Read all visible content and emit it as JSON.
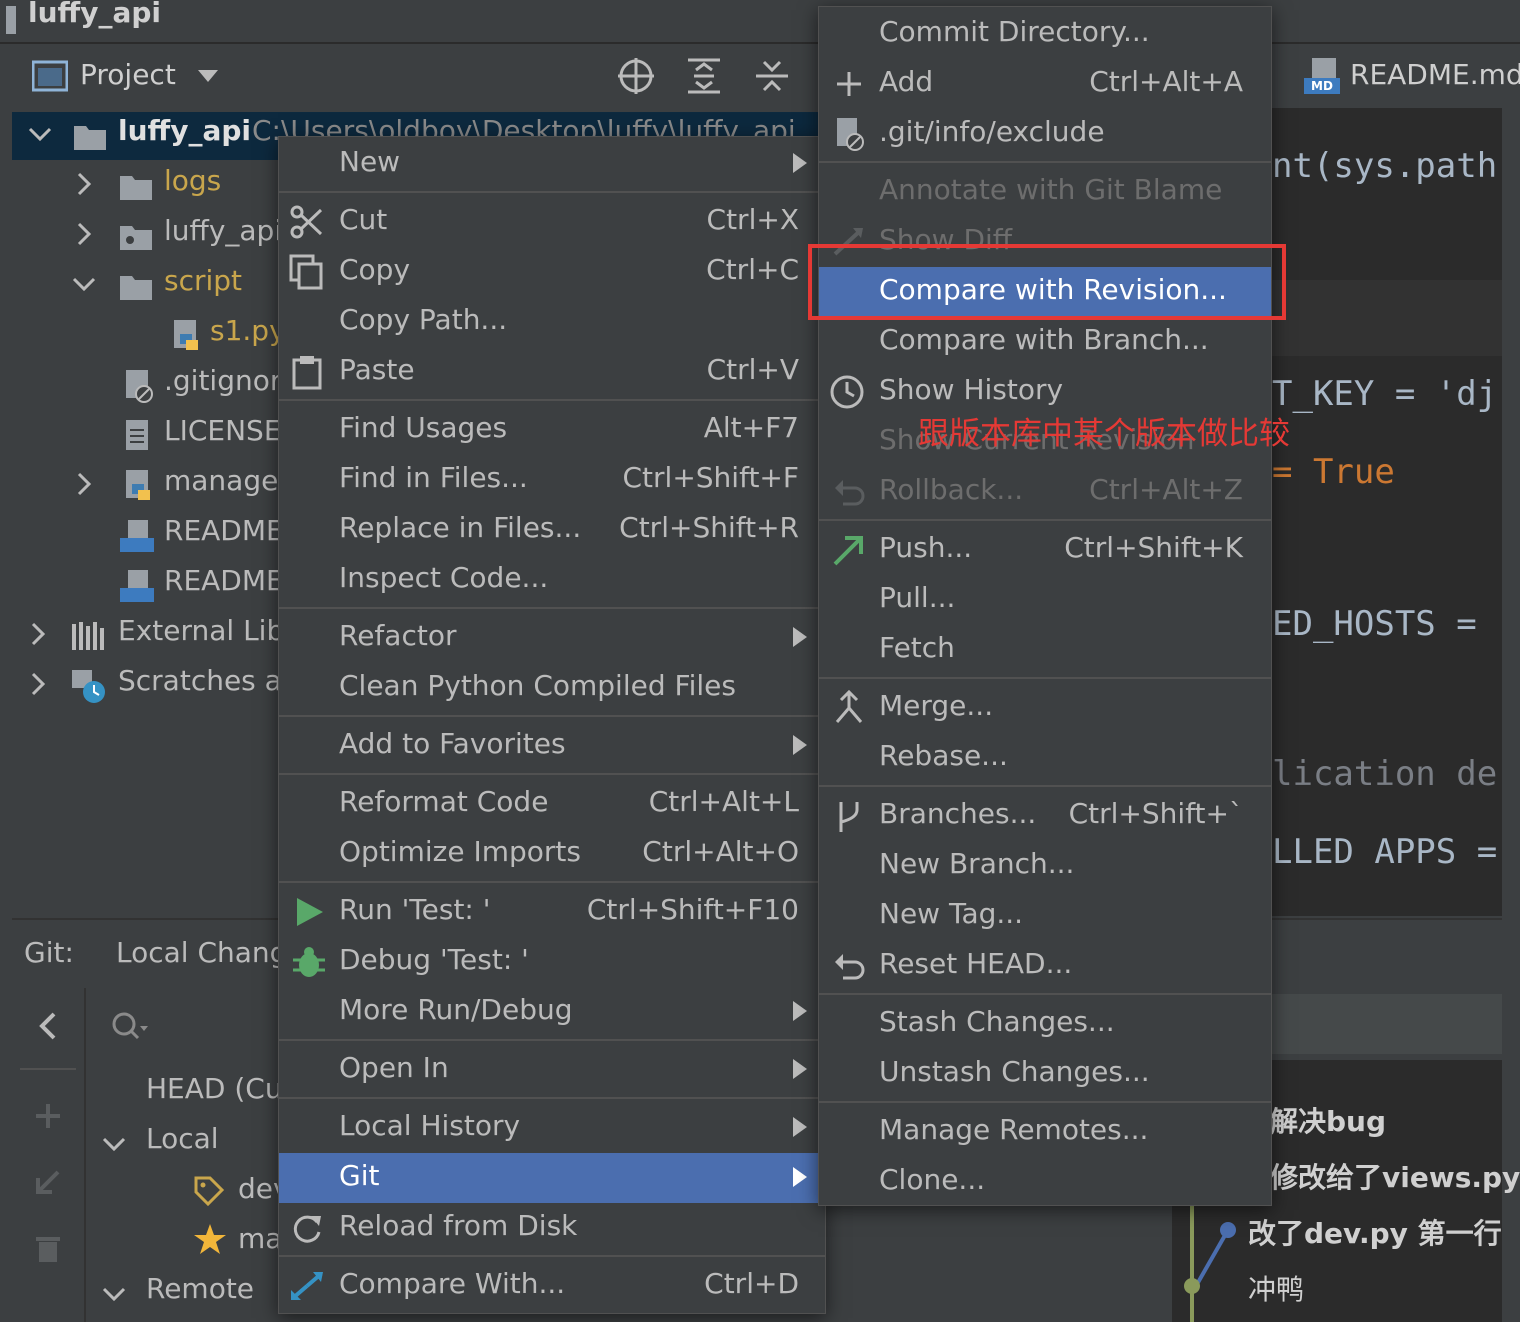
{
  "window": {
    "title": "luffy_api"
  },
  "project_panel": {
    "title": "Project",
    "tree": [
      {
        "label": "luffy_api",
        "path": "C:\\Users\\oldboy\\Desktop\\luffy\\luffy_api",
        "color": "#d0d0d0",
        "icon": "folder-icon"
      },
      {
        "label": "logs",
        "color": "#c9a64c",
        "icon": "folder-icon"
      },
      {
        "label": "luffy_api",
        "color": "#bbbbbb",
        "icon": "package-icon"
      },
      {
        "label": "script",
        "color": "#c9a64c",
        "icon": "folder-icon"
      },
      {
        "label": "s1.py",
        "color": "#c9a64c",
        "icon": "python-file-icon"
      },
      {
        "label": ".gitignore",
        "color": "#bbbbbb",
        "icon": "gitignore-file-icon"
      },
      {
        "label": "LICENSE",
        "color": "#bbbbbb",
        "icon": "text-file-icon"
      },
      {
        "label": "manage.py",
        "color": "#bbbbbb",
        "icon": "python-file-icon"
      },
      {
        "label": "README.en.md",
        "color": "#bbbbbb",
        "icon": "markdown-file-icon"
      },
      {
        "label": "README.md",
        "color": "#bbbbbb",
        "icon": "markdown-file-icon"
      },
      {
        "label": "External Libraries",
        "color": "#bbbbbb",
        "icon": "library-icon"
      },
      {
        "label": "Scratches and Consoles",
        "color": "#bbbbbb",
        "icon": "scratches-icon"
      }
    ]
  },
  "editor": {
    "tab_label": "README.md",
    "tab_badge": "MD",
    "code_fragments": [
      {
        "text": "nt(sys.path",
        "color": "#a9b7c6"
      },
      {
        "text": "T_KEY = 'dj",
        "color": "#a9b7c6"
      },
      {
        "text": " = True",
        "color": "#cc7832"
      },
      {
        "text": "ED_HOSTS = ",
        "color": "#a9b7c6"
      },
      {
        "text": "lication de",
        "color": "#7a7e85"
      },
      {
        "text": "LLED APPS =",
        "color": "#a9b7c6"
      }
    ]
  },
  "git_panel": {
    "label": "Git:",
    "tab": "Local Changes",
    "branches": {
      "head": "HEAD (Current Branch)",
      "local_label": "Local",
      "local_items": [
        "dev",
        "master"
      ],
      "remote_label": "Remote"
    },
    "log_messages": [
      "解决bug",
      "修改给了views.py的最",
      "改了dev.py 第一行",
      "冲鸭"
    ]
  },
  "context_menu": {
    "items": [
      {
        "label": "New",
        "submenu": true
      },
      {
        "label": "Cut",
        "shortcut": "Ctrl+X",
        "icon": "scissors-icon"
      },
      {
        "label": "Copy",
        "shortcut": "Ctrl+C",
        "icon": "copy-icon"
      },
      {
        "label": "Copy Path..."
      },
      {
        "label": "Paste",
        "shortcut": "Ctrl+V",
        "icon": "paste-icon"
      },
      {
        "label": "Find Usages",
        "shortcut": "Alt+F7"
      },
      {
        "label": "Find in Files...",
        "shortcut": "Ctrl+Shift+F"
      },
      {
        "label": "Replace in Files...",
        "shortcut": "Ctrl+Shift+R"
      },
      {
        "label": "Inspect Code..."
      },
      {
        "label": "Refactor",
        "submenu": true
      },
      {
        "label": "Clean Python Compiled Files"
      },
      {
        "label": "Add to Favorites",
        "submenu": true
      },
      {
        "label": "Reformat Code",
        "shortcut": "Ctrl+Alt+L"
      },
      {
        "label": "Optimize Imports",
        "shortcut": "Ctrl+Alt+O"
      },
      {
        "label": "Run 'Test: '",
        "shortcut": "Ctrl+Shift+F10",
        "icon": "run-icon"
      },
      {
        "label": "Debug 'Test: '",
        "icon": "debug-icon"
      },
      {
        "label": "More Run/Debug",
        "submenu": true
      },
      {
        "label": "Open In",
        "submenu": true
      },
      {
        "label": "Local History",
        "submenu": true
      },
      {
        "label": "Git",
        "submenu": true,
        "highlighted": true
      },
      {
        "label": "Reload from Disk",
        "icon": "reload-icon"
      },
      {
        "label": "Compare With...",
        "shortcut": "Ctrl+D",
        "icon": "compare-icon"
      }
    ]
  },
  "git_submenu": {
    "items": [
      {
        "label": "Commit Directory..."
      },
      {
        "label": "Add",
        "shortcut": "Ctrl+Alt+A",
        "icon": "plus-icon"
      },
      {
        "label": ".git/info/exclude",
        "icon": "gitignore-file-icon"
      },
      {
        "label": "Annotate with Git Blame",
        "disabled": true
      },
      {
        "label": "Show Diff",
        "disabled": true,
        "icon": "diff-icon"
      },
      {
        "label": "Compare with Revision...",
        "highlighted": true
      },
      {
        "label": "Compare with Branch..."
      },
      {
        "label": "Show History",
        "icon": "clock-icon"
      },
      {
        "label": "Show Current Revision",
        "disabled": true
      },
      {
        "label": "Rollback...",
        "shortcut": "Ctrl+Alt+Z",
        "disabled": true,
        "icon": "rollback-icon"
      },
      {
        "label": "Push...",
        "shortcut": "Ctrl+Shift+K",
        "icon": "push-icon"
      },
      {
        "label": "Pull..."
      },
      {
        "label": "Fetch"
      },
      {
        "label": "Merge...",
        "icon": "merge-icon"
      },
      {
        "label": "Rebase..."
      },
      {
        "label": "Branches...",
        "shortcut": "Ctrl+Shift+`",
        "icon": "branch-icon"
      },
      {
        "label": "New Branch..."
      },
      {
        "label": "New Tag..."
      },
      {
        "label": "Reset HEAD...",
        "icon": "reset-icon"
      },
      {
        "label": "Stash Changes..."
      },
      {
        "label": "Unstash Changes..."
      },
      {
        "label": "Manage Remotes..."
      },
      {
        "label": "Clone..."
      }
    ]
  },
  "annotation": {
    "text": "跟版本库中某个版本做比较",
    "color": "#e53935"
  },
  "colors": {
    "background": "#3c3f41",
    "editor": "#2b2b2b",
    "selection": "#4b6eaf",
    "tree_selection": "#0d293e"
  }
}
